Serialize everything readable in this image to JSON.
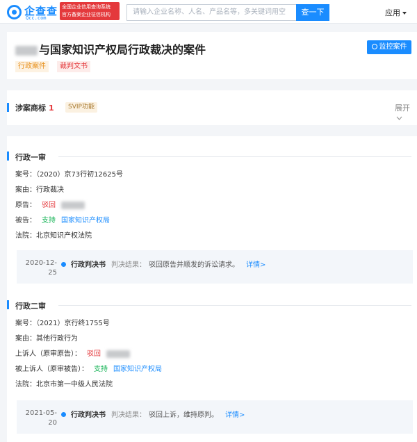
{
  "header": {
    "logo_text": "企查查",
    "logo_sub": "Qcc.com",
    "badge_line1": "全国企业信用查询系统",
    "badge_line2": "官方备案企业征信机构",
    "search_placeholder": "请输入企业名称、人名、产品名等，多关键词用空",
    "search_button": "查一下",
    "app_menu": "应用"
  },
  "case": {
    "title_suffix": "与国家知识产权局行政裁决的案件",
    "tags": [
      "行政案件",
      "裁判文书"
    ],
    "monitor_button": "监控案件"
  },
  "trademark": {
    "title": "涉案商标",
    "count": "1",
    "svip": "SVIP功能",
    "expand": "展开"
  },
  "stages": [
    {
      "title": "行政一审",
      "case_no_label": "案号：",
      "case_no": "（2020）京73行初12625号",
      "cause_label": "案由：",
      "cause": "行政裁决",
      "plaintiff_label": "原告：",
      "plaintiff_result": "驳回",
      "defendant_label": "被告：",
      "defendant_result": "支持",
      "defendant": "国家知识产权局",
      "court_label": "法院：",
      "court": "北京知识产权法院",
      "doc": {
        "date_line1": "2020-12-",
        "date_line2": "25",
        "type": "行政判决书",
        "result_label": "判决结果：",
        "result": "驳回原告并顺发的诉讼请求。",
        "link": "详情>"
      }
    },
    {
      "title": "行政二审",
      "case_no_label": "案号：",
      "case_no": "（2021）京行终1755号",
      "cause_label": "案由：",
      "cause": "其他行政行为",
      "plaintiff_label": "上诉人（原审原告）：",
      "plaintiff_result": "驳回",
      "defendant_label": "被上诉人（原审被告）：",
      "defendant_result": "支持",
      "defendant": "国家知识产权局",
      "court_label": "法院：",
      "court": "北京市第一中级人民法院",
      "doc": {
        "date_line1": "2021-05-",
        "date_line2": "20",
        "type": "行政判决书",
        "result_label": "判决结果：",
        "result": "驳回上诉，维持原判。",
        "link": "详情>"
      }
    }
  ],
  "colors": {
    "accent": "#1a8cff",
    "reject": "#e4393c",
    "support": "#14b355"
  }
}
